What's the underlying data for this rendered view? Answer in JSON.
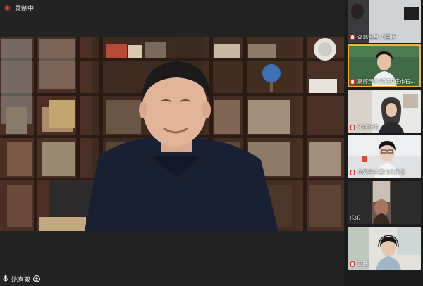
{
  "recording": {
    "label": "录制中",
    "color": "#e13b3b"
  },
  "main": {
    "self_name": "姚喜双"
  },
  "sidebar": {
    "tiles": [
      {
        "name": "湖北宜昌 刘国庆",
        "active": false
      },
      {
        "name": "高婷河北省石家庄市石...",
        "active": true
      },
      {
        "name": "沙祥杜瑜",
        "active": false
      },
      {
        "name": "内蒙乌兰察布何玉婷",
        "active": false
      },
      {
        "name": "乐乐",
        "active": false
      },
      {
        "name": "管珊",
        "active": false
      }
    ]
  },
  "colors": {
    "active_border": "#f2b233",
    "background": "#1f1f1f"
  }
}
